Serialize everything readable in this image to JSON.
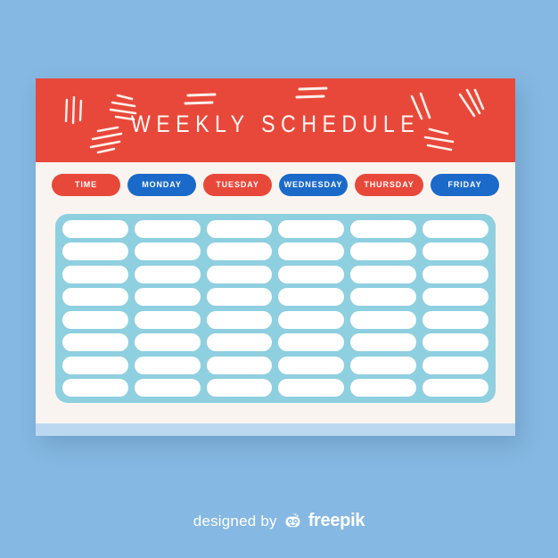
{
  "page": {
    "background_color": "#85b8e2"
  },
  "card": {
    "background_color": "#faf4f0",
    "bottom_strip_color": "#bcd8f0"
  },
  "header": {
    "title": "WEEKLY SCHEDULE",
    "background_color": "#e8483a",
    "title_color": "#fdf6f2",
    "decorations": [
      "vertical-strokes-mark",
      "diagonal-fan-mark",
      "diagonal-hatch-mark",
      "equals-mark-left",
      "equals-mark-right",
      "diagonal-strokes-right-mark",
      "diagonal-fan-right-mark",
      "diagonal-hatch-right-mark"
    ]
  },
  "day_buttons": {
    "red_color": "#e8483a",
    "blue_color": "#1b6ac9",
    "items": [
      {
        "label": "TIME",
        "color": "red"
      },
      {
        "label": "MONDAY",
        "color": "blue"
      },
      {
        "label": "TUESDAY",
        "color": "red"
      },
      {
        "label": "WEDNESDAY",
        "color": "blue"
      },
      {
        "label": "THURSDAY",
        "color": "red"
      },
      {
        "label": "FRIDAY",
        "color": "blue"
      }
    ]
  },
  "grid": {
    "panel_color": "#8ecfe0",
    "cell_color": "#ffffff",
    "columns": 6,
    "rows": 8,
    "cells": [
      [
        "",
        "",
        "",
        "",
        "",
        ""
      ],
      [
        "",
        "",
        "",
        "",
        "",
        ""
      ],
      [
        "",
        "",
        "",
        "",
        "",
        ""
      ],
      [
        "",
        "",
        "",
        "",
        "",
        ""
      ],
      [
        "",
        "",
        "",
        "",
        "",
        ""
      ],
      [
        "",
        "",
        "",
        "",
        "",
        ""
      ],
      [
        "",
        "",
        "",
        "",
        "",
        ""
      ],
      [
        "",
        "",
        "",
        "",
        "",
        ""
      ]
    ]
  },
  "footer": {
    "text": "designed by",
    "brand": "freepik",
    "logo_icon": "freepik-mascot-icon",
    "text_color": "#ffffff"
  }
}
